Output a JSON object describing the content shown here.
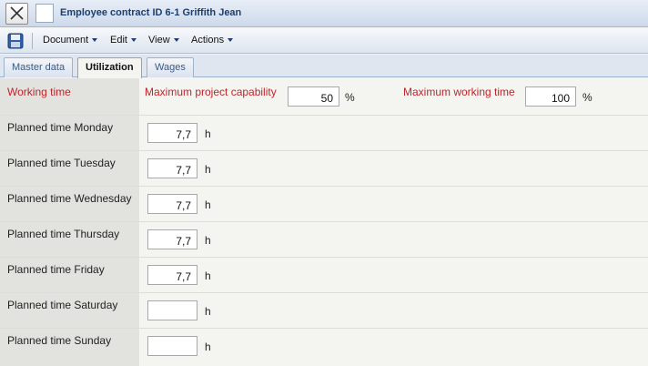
{
  "window": {
    "title": "Employee contract ID 6-1 Griffith Jean"
  },
  "toolbar": {
    "menus": [
      "Document",
      "Edit",
      "View",
      "Actions"
    ]
  },
  "tabs": [
    {
      "label": "Master data",
      "active": false
    },
    {
      "label": "Utilization",
      "active": true
    },
    {
      "label": "Wages",
      "active": false
    }
  ],
  "form": {
    "working_time_label": "Working time",
    "max_project_label": "Maximum project capability",
    "max_project_value": "50",
    "max_project_unit": "%",
    "max_working_label": "Maximum working time",
    "max_working_value": "100",
    "max_working_unit": "%",
    "days": [
      {
        "label": "Planned time Monday",
        "value": "7,7",
        "unit": "h"
      },
      {
        "label": "Planned time Tuesday",
        "value": "7,7",
        "unit": "h"
      },
      {
        "label": "Planned time Wednesday",
        "value": "7,7",
        "unit": "h"
      },
      {
        "label": "Planned time Thursday",
        "value": "7,7",
        "unit": "h"
      },
      {
        "label": "Planned time Friday",
        "value": "7,7",
        "unit": "h"
      },
      {
        "label": "Planned time Saturday",
        "value": "",
        "unit": "h"
      },
      {
        "label": "Planned time Sunday",
        "value": "",
        "unit": "h"
      }
    ]
  },
  "colors": {
    "label_red": "#c0242a",
    "label_bg": "#e2e2de",
    "form_bg": "#f4f4f0"
  }
}
